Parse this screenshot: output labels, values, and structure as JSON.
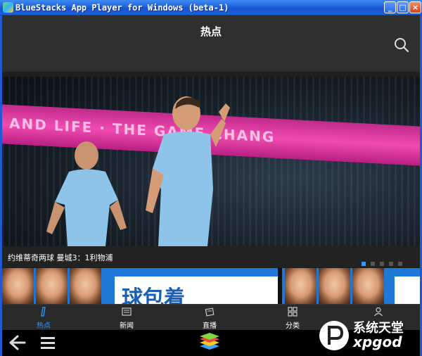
{
  "window": {
    "title": "BlueStacks App Player for Windows (beta-1)",
    "minimize": "_",
    "maximize": "□",
    "close": "×"
  },
  "header": {
    "title": "热点"
  },
  "hero": {
    "ad_text": "AND LIFE   · THE GAME CHANG",
    "caption": "约维蒂奇两球 曼城3：1利物浦",
    "slide_count": 5,
    "active_slide": 1
  },
  "cards": {
    "card1_text": "球包着",
    "card2_text": ""
  },
  "tabs": [
    {
      "label": "热点",
      "icon": "hot-icon",
      "active": true
    },
    {
      "label": "新闻",
      "icon": "news-icon",
      "active": false
    },
    {
      "label": "直播",
      "icon": "live-icon",
      "active": false
    },
    {
      "label": "分类",
      "icon": "category-icon",
      "active": false
    },
    {
      "label": "",
      "icon": "profile-icon",
      "active": false
    }
  ],
  "watermark": {
    "top": "系统天堂",
    "bottom": "xpgod"
  },
  "colors": {
    "accent": "#2f9cff",
    "header_bg": "#2f2f2f",
    "titlebar": "#1f63dd"
  }
}
